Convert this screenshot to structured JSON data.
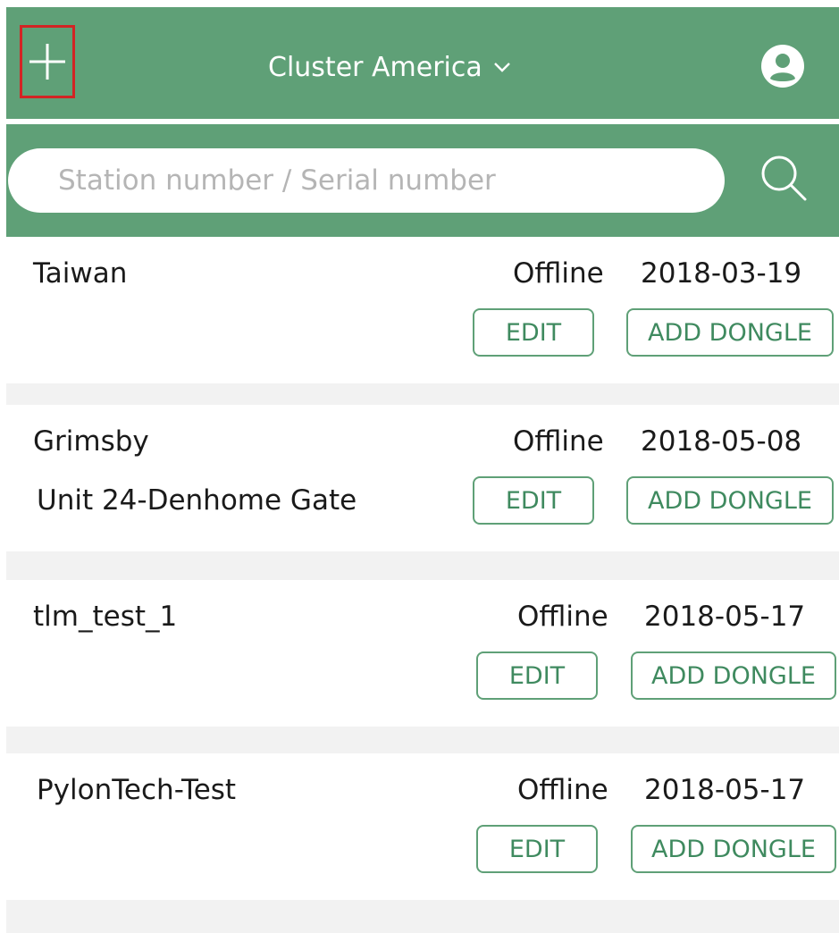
{
  "header": {
    "title": "Cluster America",
    "add_icon": "plus-icon",
    "dropdown_icon": "chevron-down-icon",
    "avatar_icon": "user-avatar-icon",
    "background_color": "#5fa077",
    "highlight_color": "#d32424"
  },
  "search": {
    "placeholder": "Station number / Serial number",
    "value": "",
    "icon": "search-icon"
  },
  "stations": [
    {
      "name": "Taiwan",
      "address": "",
      "status": "Offline",
      "date": "2018-03-19",
      "edit_label": "EDIT",
      "add_dongle_label": "ADD DONGLE"
    },
    {
      "name": "Grimsby",
      "address": "Unit 24-Denhome Gate",
      "status": "Offline",
      "date": "2018-05-08",
      "edit_label": "EDIT",
      "add_dongle_label": "ADD DONGLE"
    },
    {
      "name": "tlm_test_1",
      "address": "",
      "status": "Offline",
      "date": "2018-05-17",
      "edit_label": "EDIT",
      "add_dongle_label": "ADD DONGLE"
    },
    {
      "name": "PylonTech-Test",
      "address": "",
      "status": "Offline",
      "date": "2018-05-17",
      "edit_label": "EDIT",
      "add_dongle_label": "ADD DONGLE"
    }
  ]
}
